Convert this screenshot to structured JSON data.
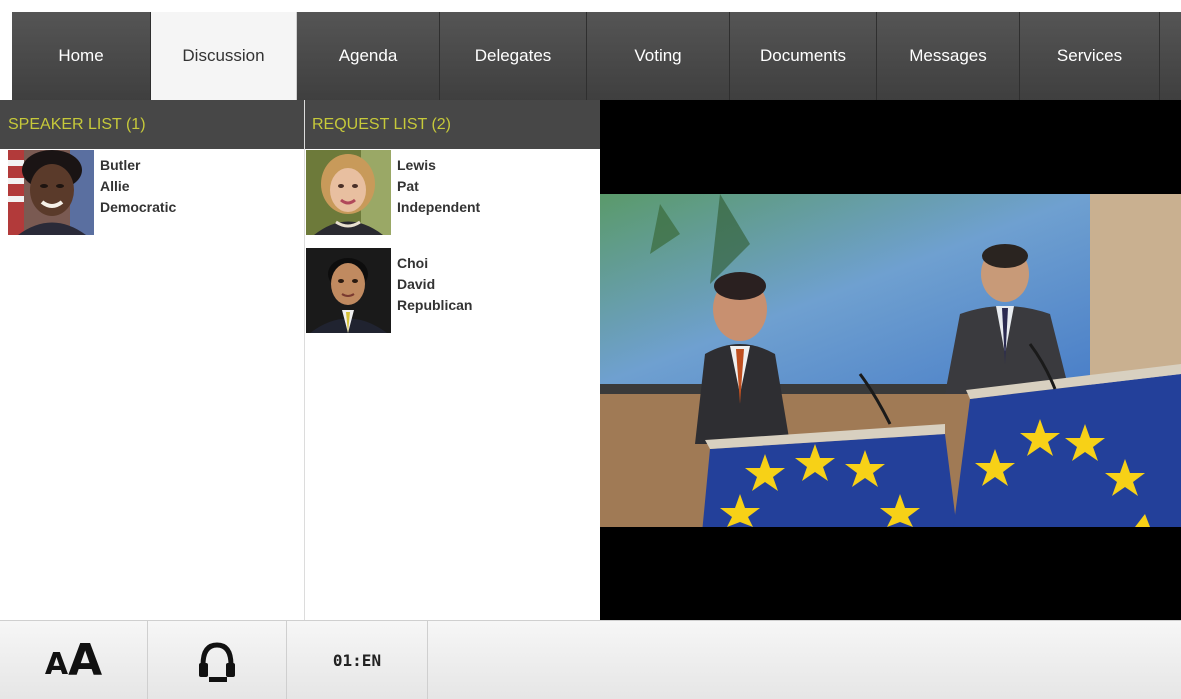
{
  "nav": {
    "tabs": [
      {
        "label": "Home"
      },
      {
        "label": "Discussion"
      },
      {
        "label": "Agenda"
      },
      {
        "label": "Delegates"
      },
      {
        "label": "Voting"
      },
      {
        "label": "Documents"
      },
      {
        "label": "Messages"
      },
      {
        "label": "Services"
      }
    ],
    "active": "Discussion"
  },
  "speaker_list": {
    "header": "SPEAKER LIST (1)",
    "items": [
      {
        "last": "Butler",
        "first": "Allie",
        "party": "Democratic"
      }
    ]
  },
  "request_list": {
    "header": "REQUEST LIST (2)",
    "items": [
      {
        "last": "Lewis",
        "first": "Pat",
        "party": "Independent"
      },
      {
        "last": "Choi",
        "first": "David",
        "party": "Republican"
      }
    ]
  },
  "bottom": {
    "font_small": "A",
    "font_big": "A",
    "language": "01:EN"
  },
  "colors": {
    "nav_bg": "#474747",
    "header_text": "#c6c93a",
    "eu_blue": "#1f3fa8",
    "eu_star": "#f7d117"
  },
  "icons": [
    "headphones-icon",
    "font-size-icon"
  ]
}
